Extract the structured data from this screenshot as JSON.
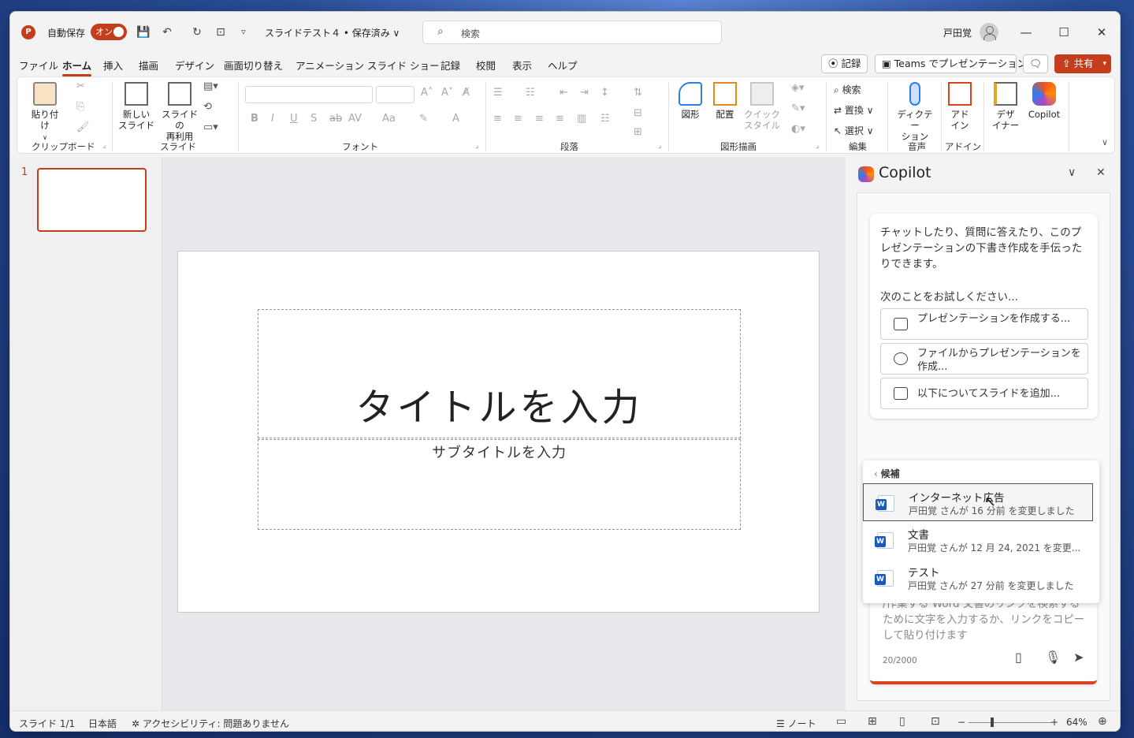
{
  "titlebar": {
    "app_icon": "P",
    "autosave_label": "自動保存",
    "autosave_state": "オン",
    "doc_title": "スライドテスト４ • 保存済み ∨",
    "search_placeholder": "検索",
    "user_name": "戸田覚",
    "minimize": "—",
    "maximize": "☐",
    "close": "✕"
  },
  "menu": {
    "tabs": [
      "ファイル",
      "ホーム",
      "挿入",
      "描画",
      "デザイン",
      "画面切り替え",
      "アニメーション",
      "スライド ショー",
      "記録",
      "校閲",
      "表示",
      "ヘルプ"
    ],
    "record_button": "⦿ 記録",
    "teams_button": "Teams でプレゼンテーション",
    "comment_icon": "🗨",
    "share_button": "共有"
  },
  "ribbon": {
    "paste": "貼り付け",
    "new_slide_1": "新しい",
    "new_slide_2": "スライド",
    "reuse_1": "スライドの",
    "reuse_2": "再利用",
    "shapes": "図形",
    "arrange": "配置",
    "quick_style_1": "クイック",
    "quick_style_2": "スタイル",
    "find": "検索",
    "replace": "置換",
    "select": "選択",
    "dictate_1": "ディクテー",
    "dictate_2": "ション",
    "addin_1": "アド",
    "addin_2": "イン",
    "designer_1": "デザ",
    "designer_2": "イナー",
    "copilot": "Copilot",
    "groups": {
      "clipboard": "クリップボード",
      "slides": "スライド",
      "font": "フォント",
      "paragraph": "段落",
      "drawing": "図形描画",
      "editing": "編集",
      "voice": "音声",
      "addins": "アドイン"
    }
  },
  "slides": {
    "thumb_number": "1",
    "title_placeholder": "タイトルを入力",
    "subtitle_placeholder": "サブタイトルを入力"
  },
  "copilot": {
    "title": "Copilot",
    "intro": "チャットしたり、質問に答えたり、このプレゼンテーションの下書き作成を手伝ったりできます。",
    "try_label": "次のことをお試しください...",
    "suggestions": [
      "プレゼンテーションを作成する...",
      "ファイルからプレゼンテーションを作成...",
      "以下についてスライドを追加..."
    ],
    "popup_header": "候補",
    "files": [
      {
        "name": "インターネット広告",
        "meta": "戸田覚 さんが 16 分前 を変更しました"
      },
      {
        "name": "文書",
        "meta": "戸田覚 さんが 12 月 24, 2021 を変更..."
      },
      {
        "name": "テスト",
        "meta": "戸田覚 さんが 27 分前 を変更しました"
      }
    ],
    "input_placeholder": "/作業する Word 文書のリンクを検索するために文字を入力するか、リンクをコピーして貼り付けます",
    "char_count": "20/2000"
  },
  "status": {
    "slide_count": "スライド 1/1",
    "language": "日本語",
    "accessibility": "アクセシビリティ: 問題ありません",
    "notes": "ノート",
    "zoom": "64%"
  },
  "colors": {
    "accent": "#c43e1c",
    "word_blue": "#185abd"
  }
}
